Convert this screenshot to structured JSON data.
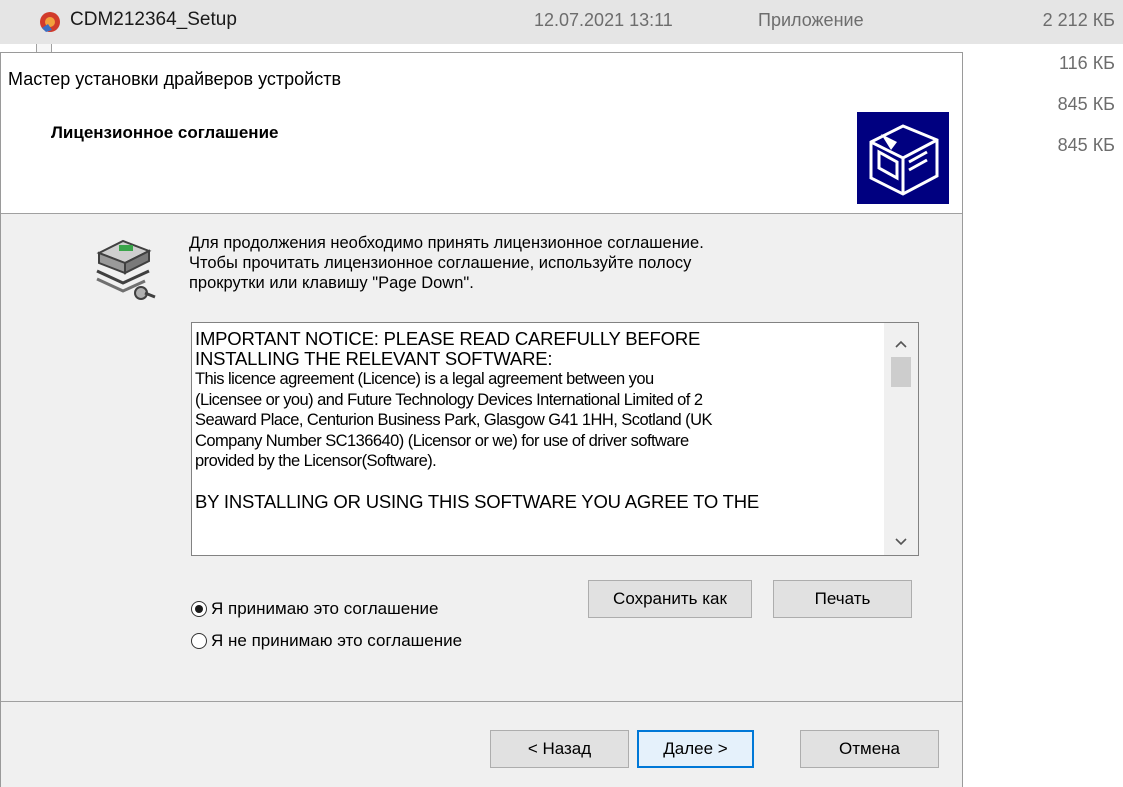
{
  "explorer": {
    "selected_file": {
      "name": "CDM212364_Setup",
      "date": "12.07.2021 13:11",
      "type": "Приложение",
      "size": "2 212 КБ"
    },
    "other_sizes": [
      "116 КБ",
      "845 КБ",
      "845 КБ"
    ]
  },
  "dialog": {
    "title": "Мастер установки драйверов устройств",
    "heading": "Лицензионное соглашение",
    "intro_lines": [
      "Для продолжения необходимо принять лицензионное соглашение.",
      "Чтобы прочитать лицензионное соглашение, используйте полосу",
      "прокрутки или клавишу \"Page Down\"."
    ],
    "license": {
      "heading_lines": [
        "IMPORTANT NOTICE: PLEASE READ CAREFULLY BEFORE",
        "INSTALLING THE RELEVANT SOFTWARE:"
      ],
      "body_lines": [
        "This licence agreement (Licence) is a legal agreement between you",
        "(Licensee or you) and Future Technology Devices International Limited of 2",
        "Seaward Place, Centurion Business Park, Glasgow G41 1HH, Scotland (UK",
        "Company Number SC136640) (Licensor or we) for use of driver software",
        "provided by the Licensor(Software)."
      ],
      "footer_line": "BY INSTALLING OR USING THIS SOFTWARE YOU AGREE TO THE"
    },
    "radio": {
      "accept_label": "Я принимаю это соглашение",
      "decline_label": "Я не принимаю это соглашение",
      "selected": "accept"
    },
    "buttons": {
      "save_as": "Сохранить как",
      "print": "Печать",
      "back": "< Назад",
      "next": "Далее >",
      "cancel": "Отмена"
    }
  }
}
